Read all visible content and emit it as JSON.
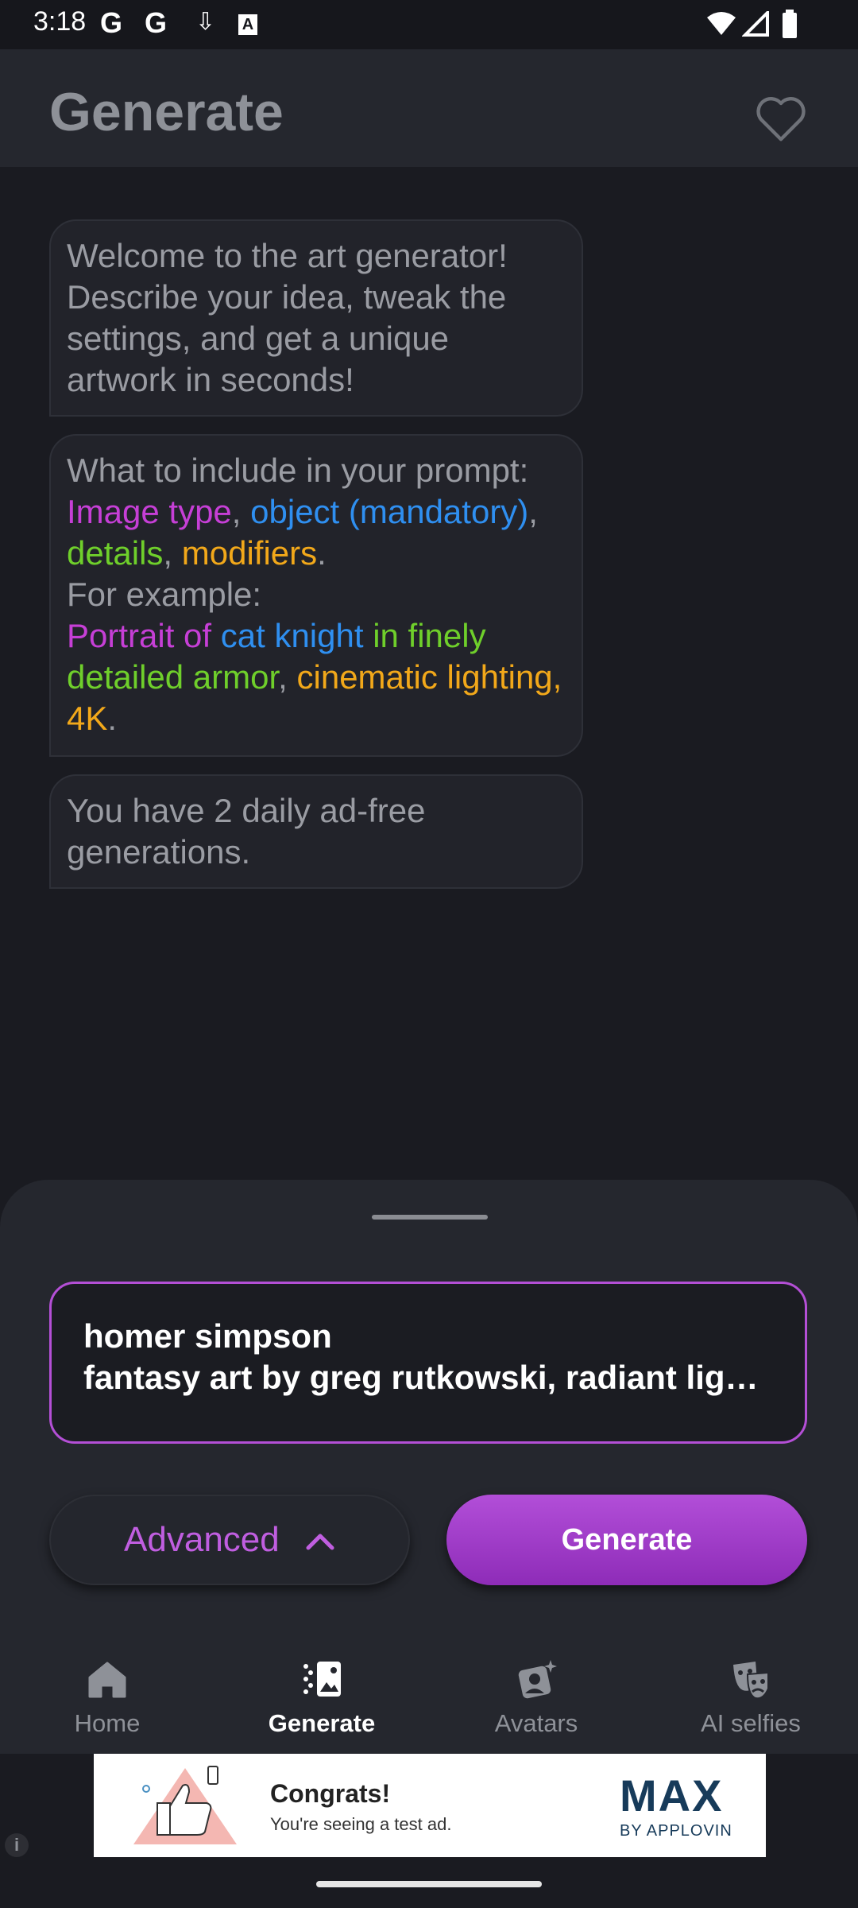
{
  "status_bar": {
    "time": "3:18",
    "icons": [
      "google-icon",
      "google-icon",
      "download-icon",
      "a-icon",
      "wifi-icon",
      "signal-icon",
      "battery-icon"
    ]
  },
  "app_bar": {
    "title": "Generate",
    "favorite_icon": "heart-icon"
  },
  "chat": {
    "welcome": "Welcome to the art generator! Describe your idea, tweak the settings, and get a unique artwork in seconds!",
    "tips": {
      "intro": "What to include in your prompt:",
      "image_type": "Image type",
      "sep1": ", ",
      "object": "object (mandatory)",
      "sep2": ",",
      "details": "details",
      "sep3": ", ",
      "modifiers": "modifiers",
      "end1": ".",
      "example_intro": "For example:",
      "ex_type": "Portrait of ",
      "ex_object": "cat knight",
      "ex_details": " in finely detailed armor",
      "ex_sep": ", ",
      "ex_modifiers": "cinematic lighting, 4K",
      "end2": "."
    },
    "quota": "You have 2 daily ad-free generations."
  },
  "prompt": {
    "line1": "homer simpson",
    "line2": "fantasy art by greg rutkowski, radiant lighting"
  },
  "buttons": {
    "advanced": "Advanced",
    "generate": "Generate"
  },
  "nav": [
    {
      "label": "Home",
      "icon": "home-icon"
    },
    {
      "label": "Generate",
      "icon": "generate-icon"
    },
    {
      "label": "Avatars",
      "icon": "avatars-icon"
    },
    {
      "label": "AI selfies",
      "icon": "ai-selfies-icon"
    }
  ],
  "ad": {
    "headline": "Congrats!",
    "subtext": "You're seeing a test ad.",
    "brand": "MAX",
    "by": "BY APPLOVIN",
    "info": "i"
  },
  "colors": {
    "accent": "#b44fd6",
    "magenta": "#c63fd6",
    "blue": "#2f8ff0",
    "green": "#6fcf2b",
    "orange": "#f2a81a"
  }
}
